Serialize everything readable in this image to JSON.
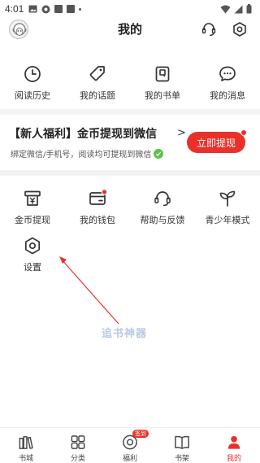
{
  "status_bar": {
    "time": "4:01"
  },
  "header": {
    "title": "我的"
  },
  "quick_items": [
    {
      "label": "阅读历史",
      "icon": "clock-icon"
    },
    {
      "label": "我的话题",
      "icon": "tag-icon"
    },
    {
      "label": "我的书单",
      "icon": "booklist-icon"
    },
    {
      "label": "我的消息",
      "icon": "message-icon"
    }
  ],
  "welfare": {
    "title": "【新人福利】金币提现到微信",
    "arrow": ">",
    "subtitle": "绑定微信/手机号，阅读均可提现到微信",
    "button_label": "立即提现"
  },
  "tools": [
    {
      "label": "金币提现",
      "icon": "coin-withdraw-icon"
    },
    {
      "label": "我的钱包",
      "icon": "wallet-icon"
    },
    {
      "label": "帮助与反馈",
      "icon": "headset-icon"
    },
    {
      "label": "青少年模式",
      "icon": "sprout-icon"
    },
    {
      "label": "设置",
      "icon": "settings-icon"
    }
  ],
  "watermark": "追书神器",
  "tabbar": {
    "items": [
      {
        "label": "书城",
        "icon": "bookstore-icon"
      },
      {
        "label": "分类",
        "icon": "category-icon"
      },
      {
        "label": "福利",
        "icon": "welfare-icon"
      },
      {
        "label": "书架",
        "icon": "bookshelf-icon"
      },
      {
        "label": "我的",
        "icon": "profile-icon"
      }
    ],
    "badge": "签到",
    "active": "我的"
  },
  "colors": {
    "accent": "#e9302a",
    "wechat_green": "#5cc24a",
    "divider": "#f3f3f3"
  }
}
